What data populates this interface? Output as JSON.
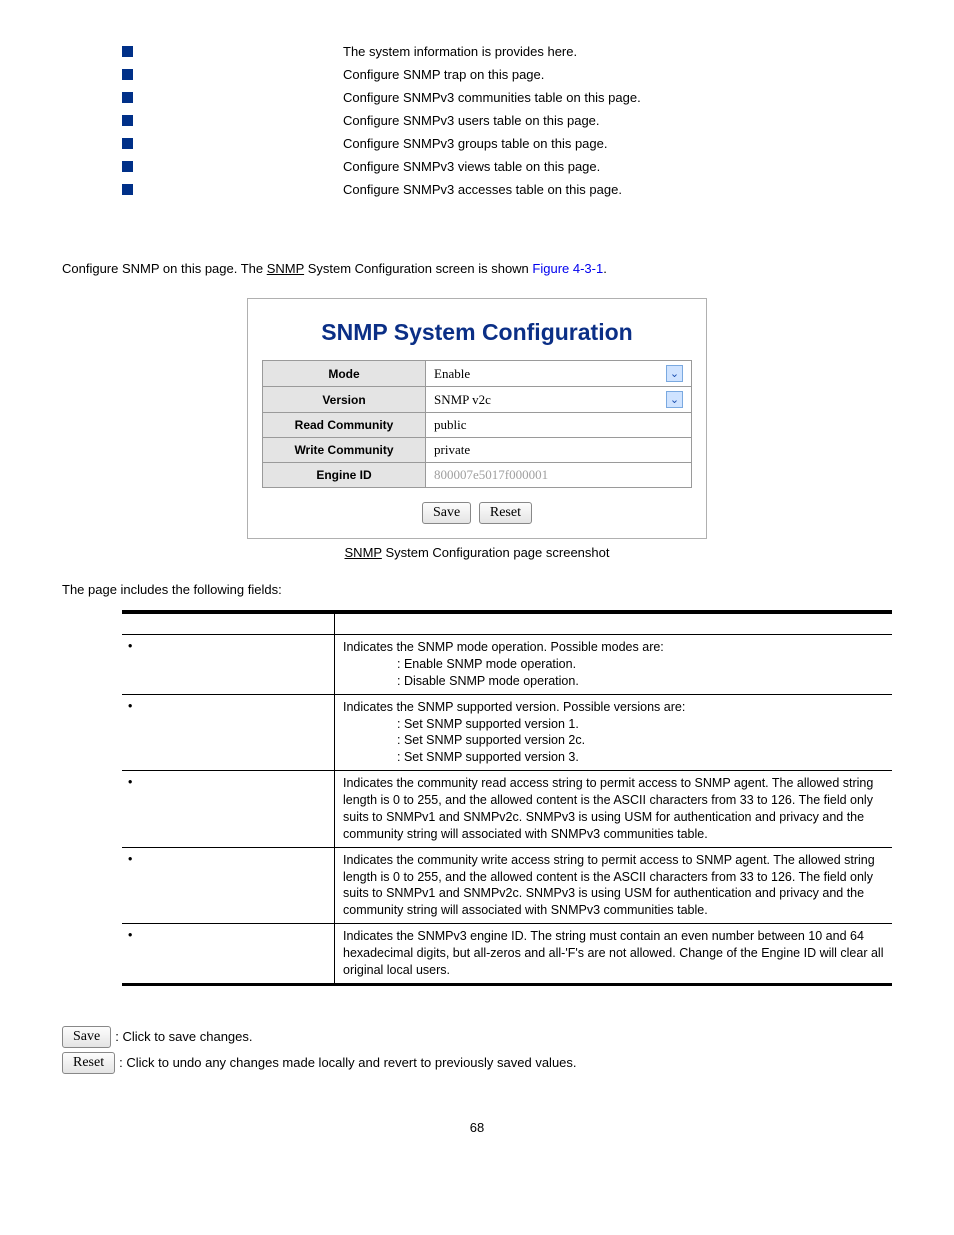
{
  "nav": [
    {
      "desc": "The system information is provides here."
    },
    {
      "desc": "Configure SNMP trap on this page."
    },
    {
      "desc": "Configure SNMPv3 communities table on this page."
    },
    {
      "desc": "Configure SNMPv3 users table on this page."
    },
    {
      "desc": "Configure SNMPv3 groups table on this page."
    },
    {
      "desc": "Configure SNMPv3 views table on this page."
    },
    {
      "desc": "Configure SNMPv3 accesses table on this page."
    }
  ],
  "intro": {
    "pre": "Configure SNMP on this page. The ",
    "under": "SNMP",
    "mid": " System Configuration screen is shown ",
    "figref": "Figure 4-3-1",
    "post": "."
  },
  "shot": {
    "title": "SNMP System Configuration",
    "rows": [
      {
        "label": "Mode",
        "value": "Enable",
        "select": true
      },
      {
        "label": "Version",
        "value": "SNMP v2c",
        "select": true
      },
      {
        "label": "Read Community",
        "value": "public",
        "select": false
      },
      {
        "label": "Write Community",
        "value": "private",
        "select": false
      },
      {
        "label": "Engine ID",
        "value": "800007e5017f000001",
        "select": false,
        "readonly": true
      }
    ],
    "save": "Save",
    "reset": "Reset"
  },
  "caption": {
    "under": "SNMP",
    "rest": " System Configuration page screenshot"
  },
  "fields_intro": "The page includes the following fields:",
  "desc": [
    {
      "d": "Indicates the SNMP mode operation. Possible modes are:",
      "sub": [
        ": Enable SNMP mode operation.",
        ": Disable SNMP mode operation."
      ]
    },
    {
      "d": "Indicates the SNMP supported version. Possible versions are:",
      "sub": [
        ": Set SNMP supported version 1.",
        ": Set SNMP supported version 2c.",
        ": Set SNMP supported version 3."
      ]
    },
    {
      "d": "Indicates the community read access string to permit access to SNMP agent. The allowed string length is 0 to 255, and the allowed content is the ASCII characters from 33 to 126. The field only suits to SNMPv1 and SNMPv2c. SNMPv3 is using USM for authentication and privacy and the community string will associated with SNMPv3 communities table."
    },
    {
      "d": "Indicates the community write access string to permit access to SNMP agent. The allowed string length is 0 to 255, and the allowed content is the ASCII characters from 33 to 126. The field only suits to SNMPv1 and SNMPv2c. SNMPv3 is using USM for authentication and privacy and the community string will associated with SNMPv3 communities table."
    },
    {
      "d": "Indicates the SNMPv3 engine ID. The string must contain an even number between 10 and 64 hexadecimal digits, but all-zeros and all-'F's are not allowed. Change of the Engine ID will clear all original local users."
    }
  ],
  "buttons": {
    "save": "Save",
    "save_desc": ": Click to save changes.",
    "reset": "Reset",
    "reset_desc": ": Click to undo any changes made locally and revert to previously saved values."
  },
  "page": "68",
  "chart_data": {
    "type": "table",
    "title": "SNMP System Configuration",
    "rows": [
      [
        "Mode",
        "Enable"
      ],
      [
        "Version",
        "SNMP v2c"
      ],
      [
        "Read Community",
        "public"
      ],
      [
        "Write Community",
        "private"
      ],
      [
        "Engine ID",
        "800007e5017f000001"
      ]
    ]
  }
}
